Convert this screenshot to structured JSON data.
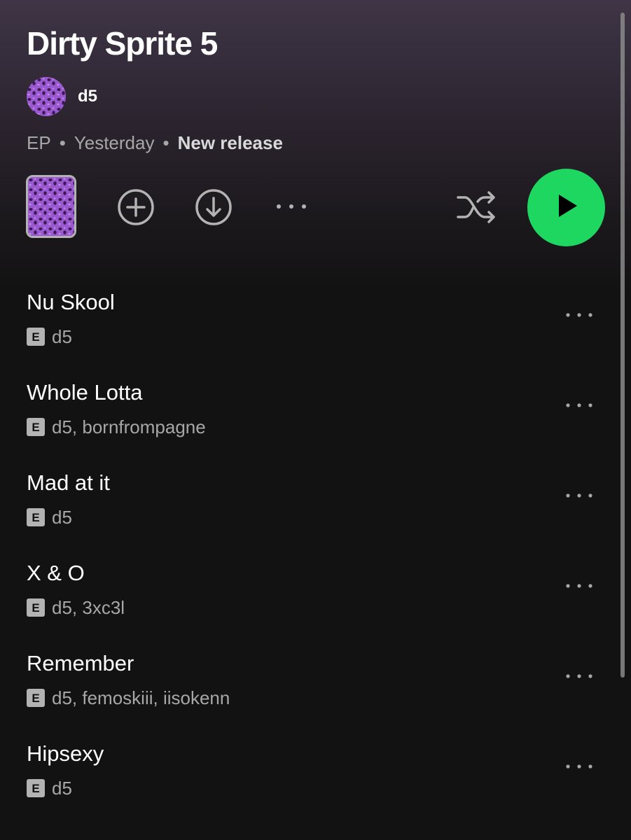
{
  "album": {
    "title": "Dirty Sprite 5",
    "artist": "d5",
    "type": "EP",
    "date": "Yesterday",
    "badge": "New release"
  },
  "meta": {
    "separator": "•"
  },
  "controls": {
    "add_icon": "plus-circle-icon",
    "download_icon": "download-circle-icon",
    "more_icon": "more-horizontal-icon",
    "shuffle_icon": "shuffle-icon",
    "play_icon": "play-icon"
  },
  "colors": {
    "accent": "#1ed760",
    "background": "#121212",
    "header_gradient_top": "#3f3546",
    "secondary_text": "#a7a7a7",
    "cover_purple": "#9b59d0"
  },
  "explicit_badge": "E",
  "tracks": [
    {
      "title": "Nu Skool",
      "artists": "d5",
      "explicit": true
    },
    {
      "title": "Whole Lotta",
      "artists": "d5, bornfrompagne",
      "explicit": true
    },
    {
      "title": "Mad at it",
      "artists": "d5",
      "explicit": true
    },
    {
      "title": "X & O",
      "artists": "d5, 3xc3l",
      "explicit": true
    },
    {
      "title": "Remember",
      "artists": "d5, femoskiii, iisokenn",
      "explicit": true
    },
    {
      "title": "Hipsexy",
      "artists": "d5",
      "explicit": true
    }
  ]
}
